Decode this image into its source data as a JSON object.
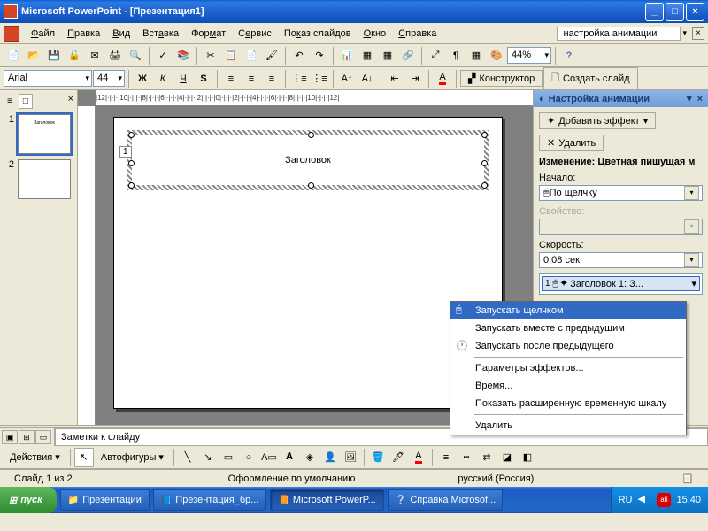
{
  "titlebar": {
    "appname": "Microsoft PowerPoint",
    "docname": "[Презентация1]"
  },
  "menubar": {
    "items": [
      "Файл",
      "Правка",
      "Вид",
      "Вставка",
      "Формат",
      "Сервис",
      "Показ слайдов",
      "Окно",
      "Справка"
    ],
    "help_field": "настройка анимации"
  },
  "formatbar": {
    "font": "Arial",
    "size": "44",
    "zoom": "44%",
    "designer": "Конструктор",
    "newslide": "Создать слайд"
  },
  "thumbs": {
    "tab_slides": "□",
    "tab_outline": "≡",
    "count": 2
  },
  "slide": {
    "title": "Заголовок",
    "placeholder_num": "1"
  },
  "taskpane": {
    "title": "Настройка анимации",
    "add_effect": "Добавить эффект",
    "delete": "Удалить",
    "change_label": "Изменение: Цветная пишущая м",
    "start_label": "Начало:",
    "start_value": "По щелчку",
    "property_label": "Свойство:",
    "speed_label": "Скорость:",
    "speed_value": "0,08 сек.",
    "anim_item": "Заголовок 1: З..."
  },
  "contextmenu": {
    "items": [
      "Запускать щелчком",
      "Запускать вместе с предыдущим",
      "Запускать после предыдущего",
      "Параметры эффектов...",
      "Время...",
      "Показать расширенную временную шкалу",
      "Удалить"
    ]
  },
  "notes": {
    "label": "Заметки к слайду"
  },
  "drawbar": {
    "actions": "Действия",
    "autoshapes": "Автофигуры"
  },
  "statusbar": {
    "slide": "Слайд 1 из 2",
    "design": "Оформление по умолчанию",
    "lang": "русский (Россия)"
  },
  "taskbar": {
    "start": "пуск",
    "buttons": [
      "Презентации",
      "Презентация_бр...",
      "Microsoft PowerP...",
      "Справка Microsof..."
    ],
    "lang": "RU",
    "time": "15:40"
  },
  "ruler_marks": "|12|·|·|·|10|·|·|·|8|·|·|·|6|·|·|·|4|·|·|·|2|·|·|·|0|·|·|·|2|·|·|·|4|·|·|·|6|·|·|·|8|·|·|·|10|·|·|·|12|"
}
